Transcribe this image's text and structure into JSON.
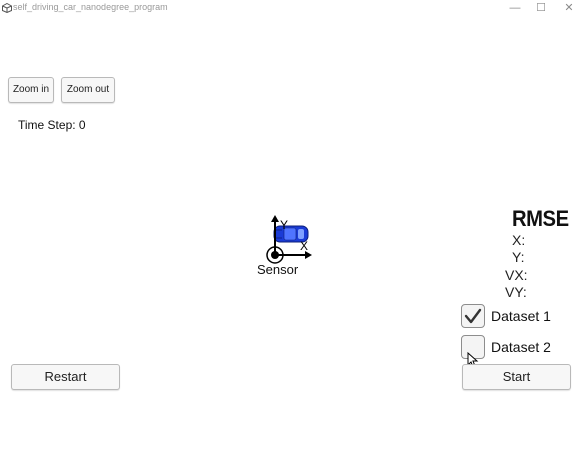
{
  "window": {
    "title": "self_driving_car_nanodegree_program",
    "minimize_symbol": "—",
    "maximize_symbol": "☐",
    "close_symbol": "✕",
    "app_icon": "unity-icon"
  },
  "zoom": {
    "zoom_in_label": "Zoom in",
    "zoom_out_label": "Zoom out"
  },
  "status": {
    "time_step_text": "Time Step: 0"
  },
  "scene": {
    "sensor_label": "Sensor",
    "x_axis_label": "X",
    "y_axis_label": "Y",
    "car_color": "#1a3bd6"
  },
  "rmse": {
    "title": "RMSE",
    "x_label": "X:",
    "y_label": "Y:",
    "vx_label": "VX:",
    "vy_label": "VY:"
  },
  "datasets": [
    {
      "label": "Dataset 1",
      "checked": true
    },
    {
      "label": "Dataset 2",
      "checked": false
    }
  ],
  "controls": {
    "restart_label": "Restart",
    "start_label": "Start"
  }
}
